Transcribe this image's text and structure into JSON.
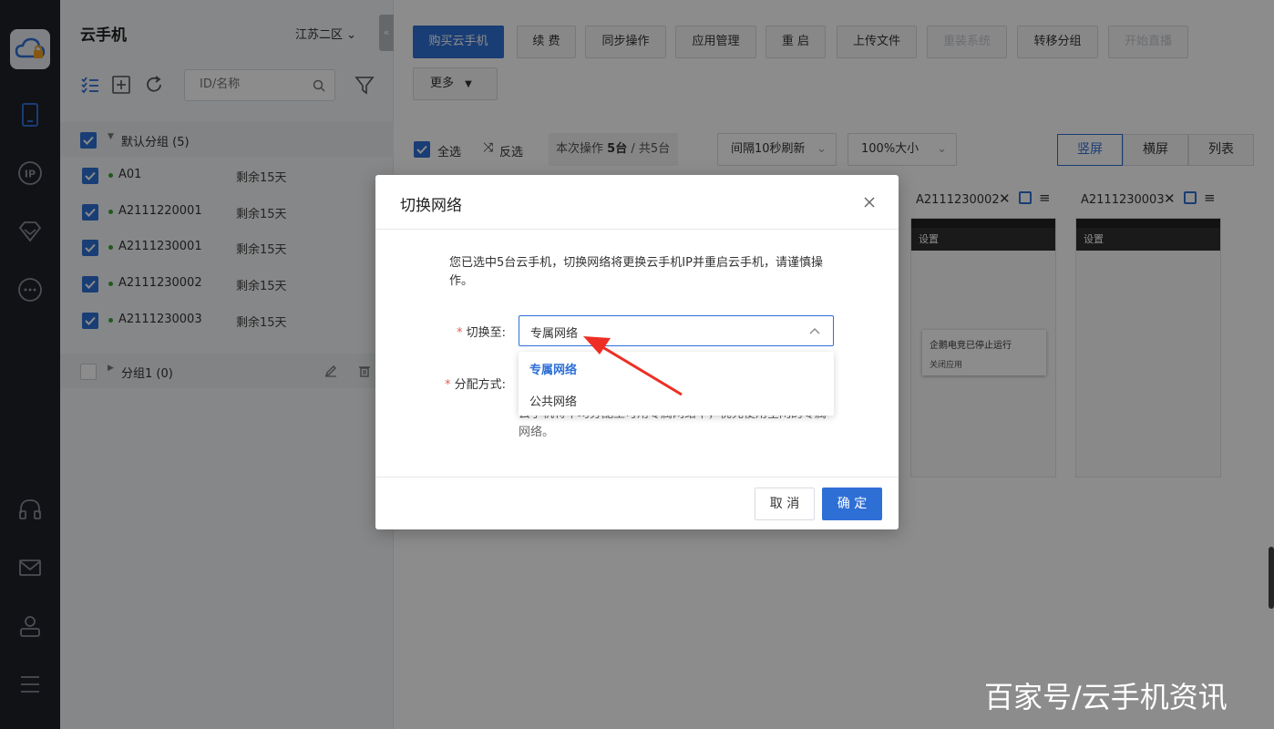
{
  "app": {
    "title": "云手机",
    "region": "江苏二区"
  },
  "search": {
    "placeholder": "ID/名称"
  },
  "groups": [
    {
      "label": "默认分组 (5)"
    },
    {
      "label": "分组1 (0)"
    }
  ],
  "devices": [
    {
      "id": "A01",
      "remain": "剩余15天"
    },
    {
      "id": "A2111220001",
      "remain": "剩余15天"
    },
    {
      "id": "A2111230001",
      "remain": "剩余15天"
    },
    {
      "id": "A2111230002",
      "remain": "剩余15天"
    },
    {
      "id": "A2111230003",
      "remain": "剩余15天"
    }
  ],
  "toolbar": {
    "buy": "购买云手机",
    "renew": "续 费",
    "sync": "同步操作",
    "apps": "应用管理",
    "restart": "重 启",
    "upload": "上传文件",
    "reinstall": "重装系统",
    "move": "转移分组",
    "live": "开始直播",
    "more": "更多"
  },
  "select_bar": {
    "all": "全选",
    "invert": "反选",
    "count_prefix": "本次操作",
    "count_num": "5台",
    "count_suffix": "/ 共5台",
    "refresh": "间隔10秒刷新",
    "size": "100%大小",
    "portrait": "竖屏",
    "landscape": "横屏",
    "list": "列表"
  },
  "phones": [
    {
      "id": "A2111230002"
    },
    {
      "id": "A2111230003"
    }
  ],
  "phone_screen": {
    "header": "设置",
    "popup_title": "企鹅电竞已停止运行",
    "popup_action": "关闭应用"
  },
  "modal": {
    "title": "切换网络",
    "warning": "您已选中5台云手机，切换网络将更换云手机IP并重启云手机，请谨慎操作。",
    "switch_label": "切换至:",
    "switch_value": "专属网络",
    "alloc_label": "分配方式:",
    "hint": "云手机将平均分配至可用专属网络中，优先使用空闲的专属网络。",
    "options": [
      "专属网络",
      "公共网络"
    ],
    "cancel": "取 消",
    "ok": "确 定"
  },
  "watermark": "百家号/云手机资讯",
  "colors": {
    "accent": "#2e6fd6",
    "rail": "#1f2229",
    "online": "#3aa33a"
  }
}
